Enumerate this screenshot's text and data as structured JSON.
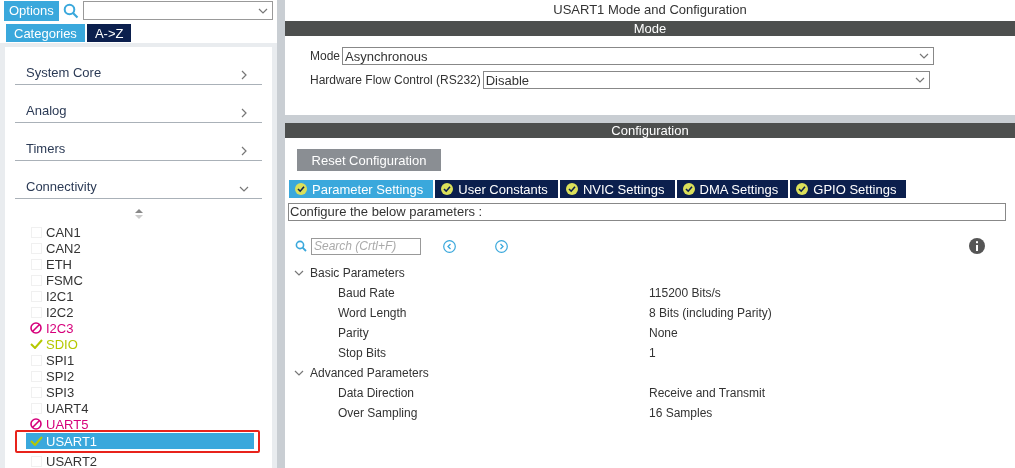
{
  "sidebar": {
    "options_button": "Options",
    "view_tabs": [
      {
        "label": "Categories",
        "selected": true
      },
      {
        "label": "A->Z",
        "selected": false
      }
    ],
    "categories": [
      {
        "label": "System Core",
        "expanded": false
      },
      {
        "label": "Analog",
        "expanded": false
      },
      {
        "label": "Timers",
        "expanded": false
      },
      {
        "label": "Connectivity",
        "expanded": true
      }
    ],
    "peripherals": [
      {
        "label": "CAN1",
        "kind": "none",
        "selected": false,
        "highlighted": false
      },
      {
        "label": "CAN2",
        "kind": "none",
        "selected": false,
        "highlighted": false
      },
      {
        "label": "ETH",
        "kind": "none",
        "selected": false,
        "highlighted": false
      },
      {
        "label": "FSMC",
        "kind": "none",
        "selected": false,
        "highlighted": false
      },
      {
        "label": "I2C1",
        "kind": "none",
        "selected": false,
        "highlighted": false
      },
      {
        "label": "I2C2",
        "kind": "none",
        "selected": false,
        "highlighted": false
      },
      {
        "label": "I2C3",
        "kind": "error",
        "selected": false,
        "highlighted": false
      },
      {
        "label": "SDIO",
        "kind": "ok",
        "selected": false,
        "highlighted": false
      },
      {
        "label": "SPI1",
        "kind": "none",
        "selected": false,
        "highlighted": false
      },
      {
        "label": "SPI2",
        "kind": "none",
        "selected": false,
        "highlighted": false
      },
      {
        "label": "SPI3",
        "kind": "none",
        "selected": false,
        "highlighted": false
      },
      {
        "label": "UART4",
        "kind": "none",
        "selected": false,
        "highlighted": false
      },
      {
        "label": "UART5",
        "kind": "error",
        "selected": false,
        "highlighted": false
      },
      {
        "label": "USART1",
        "kind": "ok",
        "selected": true,
        "highlighted": true
      },
      {
        "label": "USART2",
        "kind": "none",
        "selected": false,
        "highlighted": false
      }
    ]
  },
  "main": {
    "title": "USART1 Mode and Configuration",
    "mode_section": {
      "header": "Mode",
      "fields": [
        {
          "label": "Mode",
          "value": "Asynchronous"
        },
        {
          "label": "Hardware Flow Control (RS232)",
          "value": "Disable"
        }
      ]
    },
    "config_section": {
      "header": "Configuration",
      "reset_button": "Reset Configuration",
      "tabs": [
        {
          "label": "Parameter Settings",
          "selected": true
        },
        {
          "label": "User Constants",
          "selected": false
        },
        {
          "label": "NVIC Settings",
          "selected": false
        },
        {
          "label": "DMA Settings",
          "selected": false
        },
        {
          "label": "GPIO Settings",
          "selected": false
        }
      ],
      "description": "Configure the below parameters :",
      "search": {
        "placeholder": "Search (Crtl+F)"
      },
      "groups": [
        {
          "label": "Basic Parameters",
          "expanded": true,
          "children": [
            {
              "name": "Baud Rate",
              "value": "115200 Bits/s"
            },
            {
              "name": "Word Length",
              "value": "8 Bits (including Parity)"
            },
            {
              "name": "Parity",
              "value": "None"
            },
            {
              "name": "Stop Bits",
              "value": "1"
            }
          ]
        },
        {
          "label": "Advanced Parameters",
          "expanded": true,
          "children": [
            {
              "name": "Data Direction",
              "value": "Receive and Transmit"
            },
            {
              "name": "Over Sampling",
              "value": "16 Samples"
            }
          ]
        }
      ]
    }
  }
}
